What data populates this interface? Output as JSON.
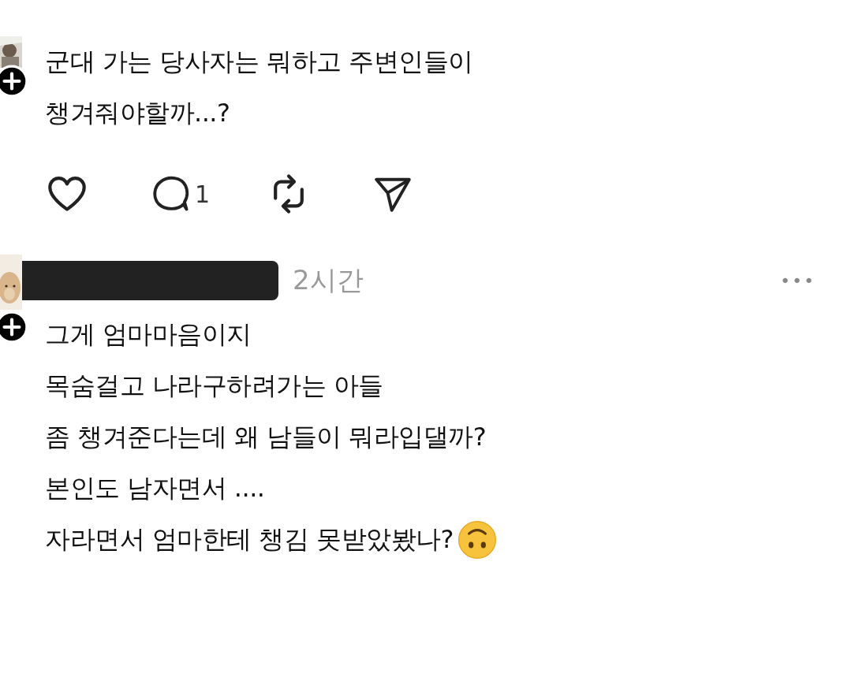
{
  "post": {
    "lines": [
      "군대 가는 당사자는 뭐하고 주변인들이",
      "챙겨줘야할까...?"
    ],
    "actions": {
      "liked": false,
      "reply_count": "1"
    }
  },
  "comment": {
    "time": "2시간",
    "more": "•••",
    "lines": [
      "그게 엄마마음이지",
      "목숨걸고 나라구하려가는 아들",
      "좀 챙겨준다는데 왜 남들이 뭐라입댈까?",
      "본인도 남자면서 ....",
      "자라면서 엄마한테 챙김 못받았봤나?"
    ]
  }
}
